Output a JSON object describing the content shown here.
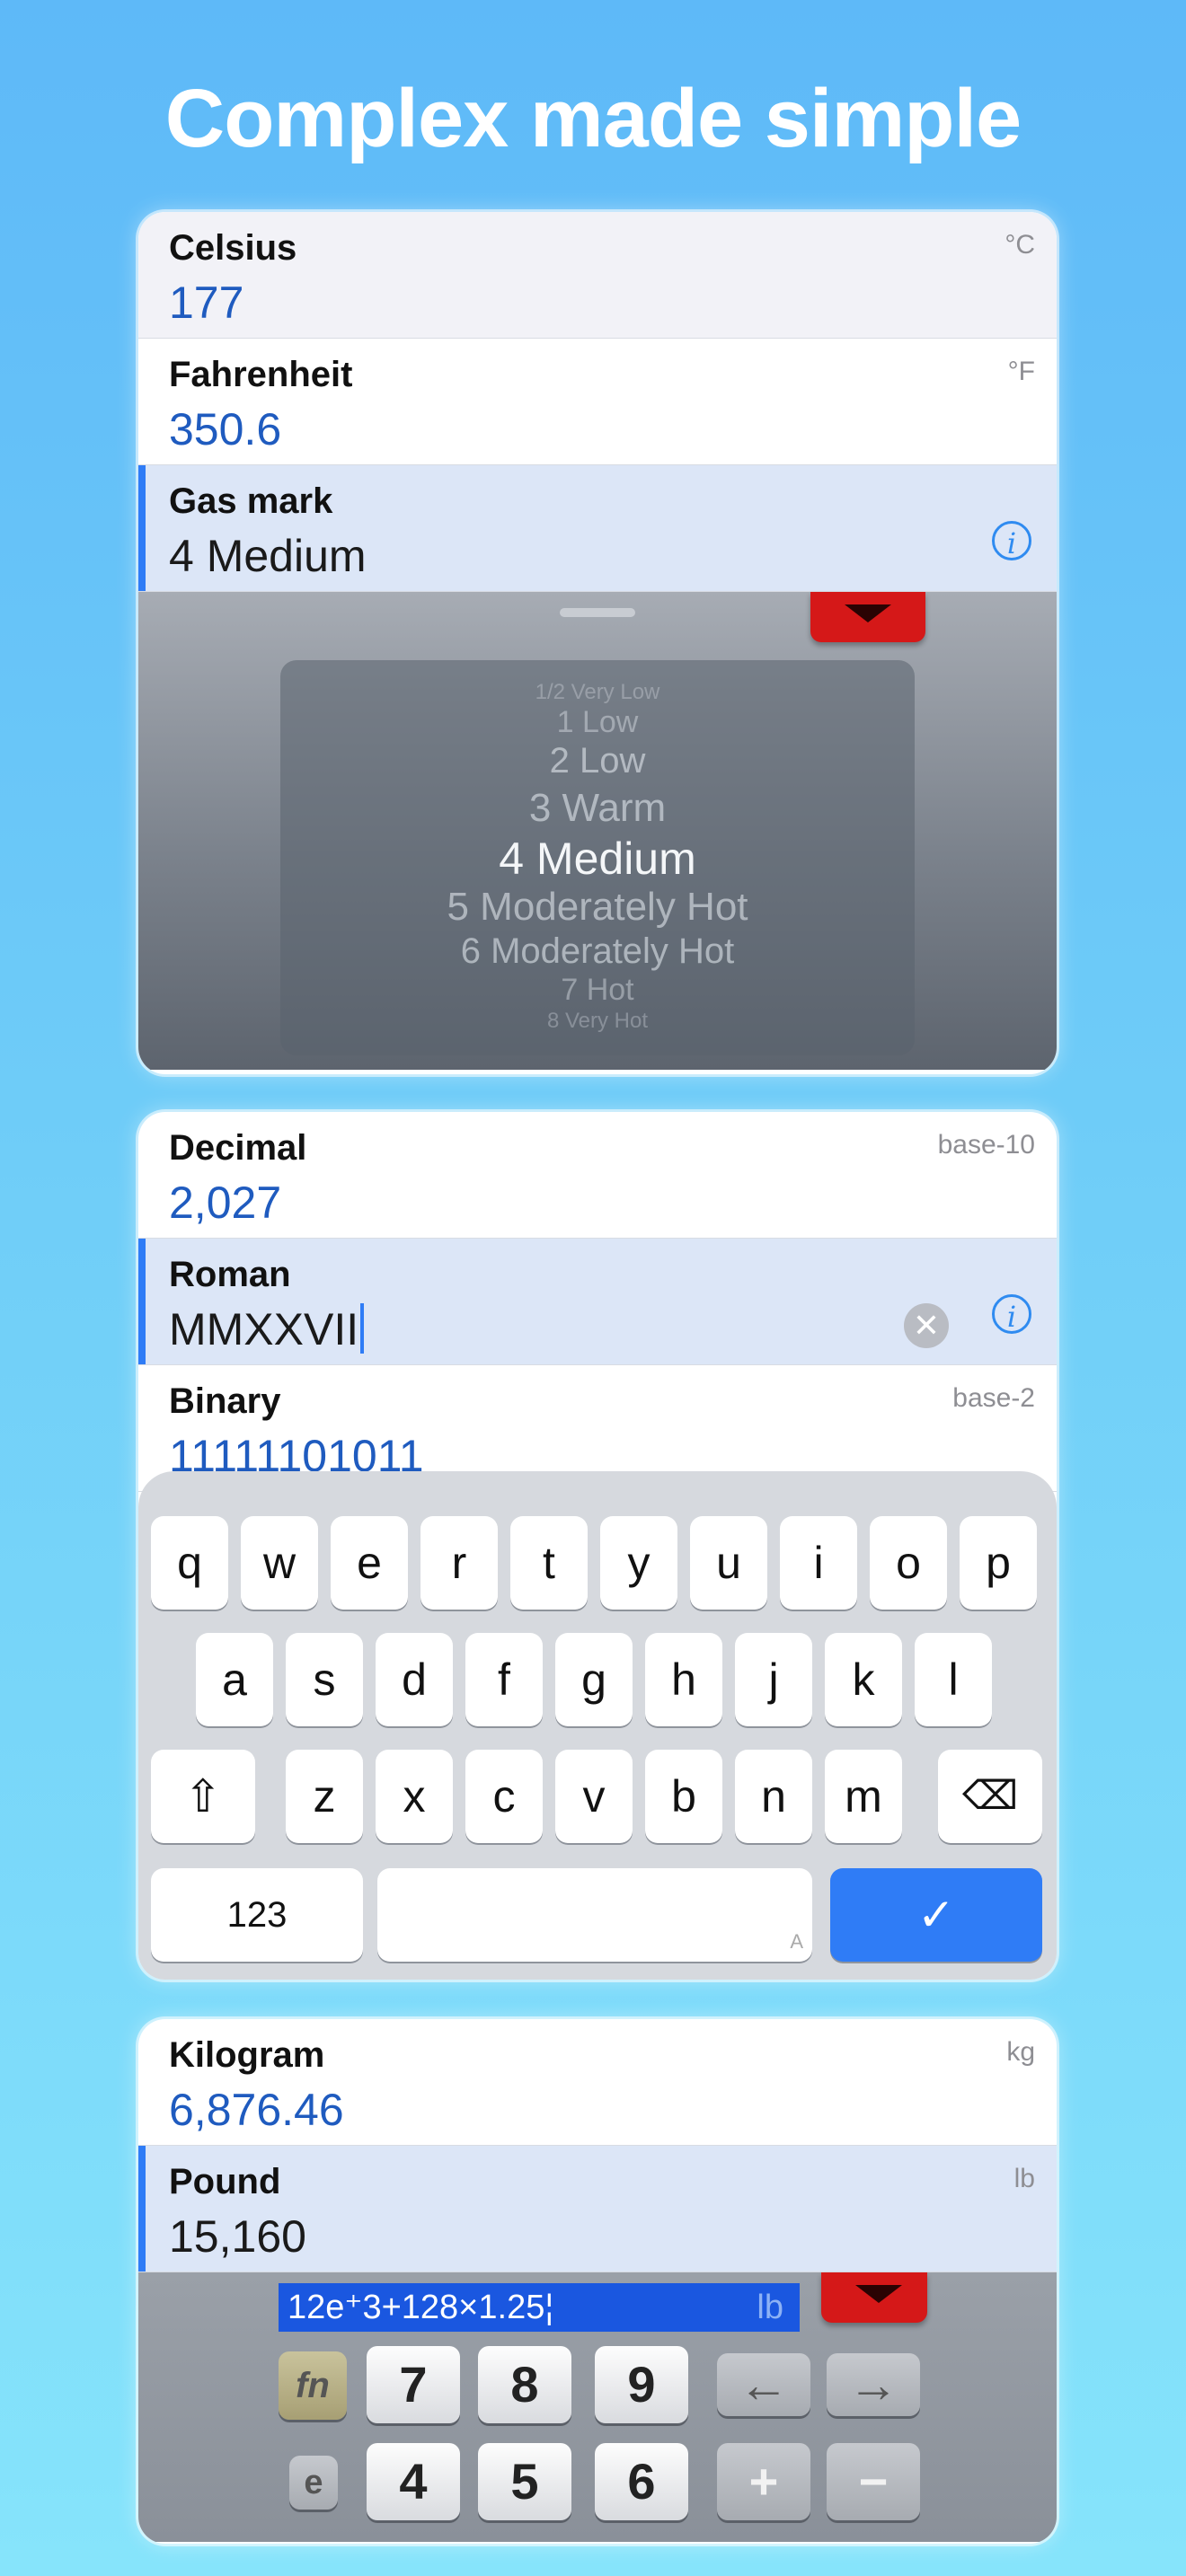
{
  "headline": "Complex made simple",
  "card1": {
    "rows": [
      {
        "label": "Celsius",
        "value": "177",
        "unit": "°C"
      },
      {
        "label": "Fahrenheit",
        "value": "350.6",
        "unit": "°F"
      },
      {
        "label": "Gas mark",
        "value": "4 Medium"
      }
    ],
    "picker": {
      "items": [
        "1/2 Very Low",
        "1 Low",
        "2 Low",
        "3 Warm",
        "4 Medium",
        "5 Moderately Hot",
        "6 Moderately Hot",
        "7 Hot",
        "8 Very Hot"
      ],
      "selected": "4 Medium"
    }
  },
  "card2": {
    "rows": [
      {
        "label": "Decimal",
        "value": "2,027",
        "unit": "base-10"
      },
      {
        "label": "Roman",
        "value": "MMXXVII"
      },
      {
        "label": "Binary",
        "value": "11111101011",
        "unit": "base-2"
      }
    ],
    "keyboard": {
      "row1": [
        "q",
        "w",
        "e",
        "r",
        "t",
        "y",
        "u",
        "i",
        "o",
        "p"
      ],
      "row2": [
        "a",
        "s",
        "d",
        "f",
        "g",
        "h",
        "j",
        "k",
        "l"
      ],
      "row3": [
        "z",
        "x",
        "c",
        "v",
        "b",
        "n",
        "m"
      ],
      "shift": "⇧",
      "backspace": "⌫",
      "numbers": "123",
      "space_hint": "A",
      "done": "✓"
    }
  },
  "card3": {
    "rows": [
      {
        "label": "Kilogram",
        "value": "6,876.46",
        "unit": "kg"
      },
      {
        "label": "Pound",
        "value": "15,160",
        "unit": "lb"
      }
    ],
    "calculator": {
      "expression": "12e⁺3+128×1.25¦",
      "expression_unit": "lb",
      "fn": "fn",
      "e": "e",
      "keys_row1": [
        "7",
        "8",
        "9"
      ],
      "keys_row2": [
        "4",
        "5",
        "6"
      ],
      "left": "←",
      "right": "→",
      "plus": "+",
      "minus": "−"
    }
  }
}
